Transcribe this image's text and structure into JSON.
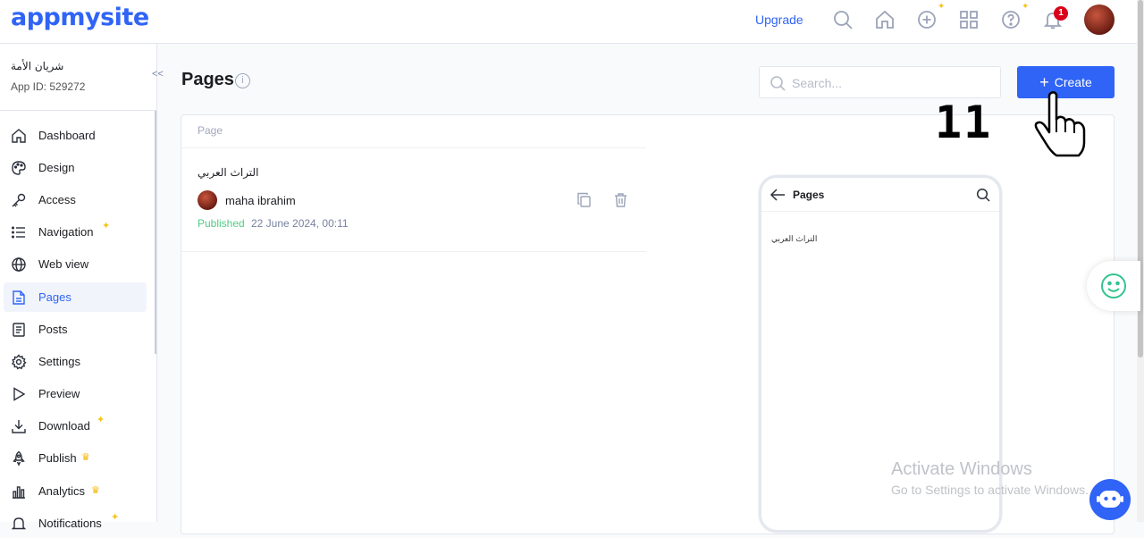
{
  "header": {
    "logo": "appmysite",
    "upgrade_label": "Upgrade",
    "notification_count": "1"
  },
  "sidebar": {
    "app_name": "شريان الأمة",
    "app_id": "App ID: 529272",
    "collapse_glyph": "<<",
    "items": [
      {
        "label": "Dashboard",
        "icon": "home-icon"
      },
      {
        "label": "Design",
        "icon": "palette-icon"
      },
      {
        "label": "Access",
        "icon": "key-icon"
      },
      {
        "label": "Navigation",
        "icon": "list-icon",
        "new": true
      },
      {
        "label": "Web view",
        "icon": "globe-icon"
      },
      {
        "label": "Pages",
        "icon": "page-icon",
        "active": true
      },
      {
        "label": "Posts",
        "icon": "posts-icon"
      },
      {
        "label": "Settings",
        "icon": "gear-icon"
      },
      {
        "label": "Preview",
        "icon": "play-icon"
      },
      {
        "label": "Download",
        "icon": "download-icon",
        "new": true
      },
      {
        "label": "Publish",
        "icon": "rocket-icon",
        "premium": true
      },
      {
        "label": "Analytics",
        "icon": "bar-chart-icon",
        "premium": true
      },
      {
        "label": "Notifications",
        "icon": "bell-icon",
        "new": true
      }
    ]
  },
  "main": {
    "title": "Pages",
    "info_glyph": "i",
    "search_placeholder": "Search...",
    "create_label": "Create",
    "create_glyph": "+",
    "table": {
      "column_header": "Page",
      "rows": [
        {
          "title": "التراث العربي",
          "author": "maha ibrahim",
          "status": "Published",
          "date": "22 June 2024, 00:11"
        }
      ]
    },
    "preview": {
      "title": "Pages",
      "item": "التراث العربي"
    }
  },
  "overlay": {
    "step_number": "11",
    "watermark_title": "Activate Windows",
    "watermark_sub": "Go to Settings to activate Windows."
  },
  "colors": {
    "accent": "#3064f6",
    "published": "#52cb86",
    "badge": "#d9001b",
    "premium": "#f2b705",
    "smiley": "#34c38f"
  }
}
